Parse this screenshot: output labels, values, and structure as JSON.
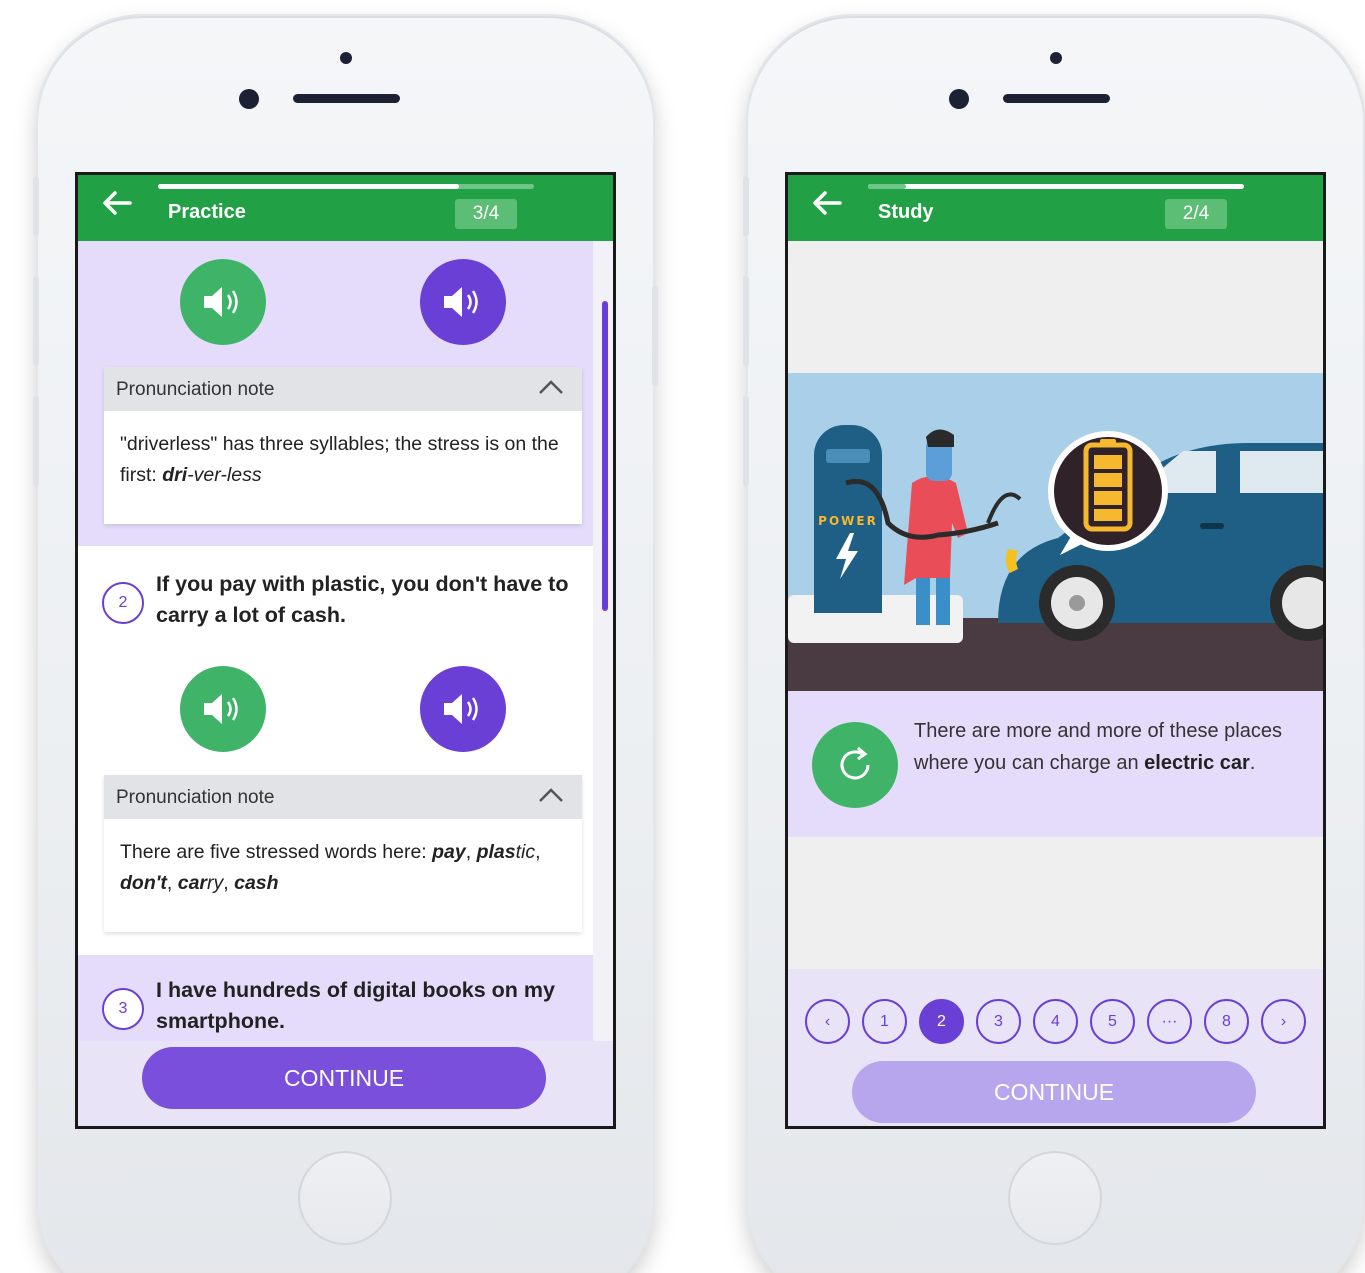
{
  "colors": {
    "green": "#22a045",
    "purple": "#6a3fd6",
    "lavender": "#e4dcfa",
    "cta_active": "#7a4fdc",
    "cta_disabled": "#b7a6ee"
  },
  "practice_screen": {
    "title": "Practice",
    "progress_badge": "3/4",
    "progress_fraction": 0.8,
    "items": [
      {
        "note": {
          "header": "Pronunciation note",
          "text_prefix": "\"driverless\" has three syllables; the stress is on the first: ",
          "stress_bold": "dri",
          "stress_rest": "-ver-less"
        }
      },
      {
        "number": "2",
        "sentence": "If you pay with plastic, you don't have to carry a lot of cash.",
        "note": {
          "header": "Pronunciation note",
          "text_prefix": "There are five stressed words here: ",
          "w1": "pay",
          "sep1": ", ",
          "w2a": "plas",
          "w2b": "tic",
          "sep2": ", ",
          "w3": "don't",
          "sep3": ", ",
          "w4a": "car",
          "w4b": "ry",
          "sep4": ", ",
          "w5": "cash"
        }
      },
      {
        "number": "3",
        "sentence": "I have hundreds of digital books on my smartphone."
      }
    ],
    "continue_label": "CONTINUE"
  },
  "study_screen": {
    "title": "Study",
    "progress_badge": "2/4",
    "progress_fraction": 0.1,
    "illustration": {
      "charger_label": "POWER"
    },
    "card_text_prefix": "There are more and more of these places where you can charge an ",
    "card_text_bold": "electric car",
    "card_text_suffix": ".",
    "pager": {
      "prev": "‹",
      "pages": [
        "1",
        "2",
        "3",
        "4",
        "5",
        "···",
        "8"
      ],
      "active_page": "2",
      "next": "›"
    },
    "continue_label": "CONTINUE"
  }
}
